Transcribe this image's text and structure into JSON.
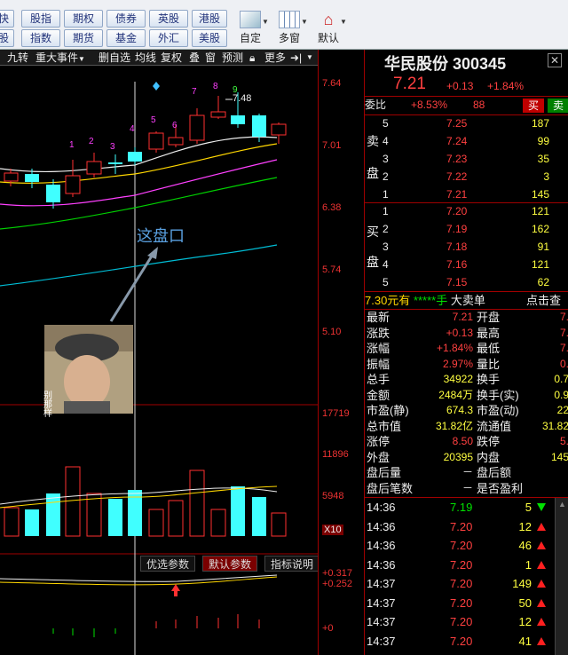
{
  "toolbar": {
    "row1": [
      "快",
      "股指",
      "期权",
      "债券",
      "英股",
      "港股"
    ],
    "row2": [
      "股",
      "指数",
      "期货",
      "基金",
      "外汇",
      "美股"
    ],
    "big": [
      "自定",
      "多窗",
      "默认"
    ]
  },
  "chartbar": {
    "items": [
      "九转",
      "重大事件",
      "删自选",
      "均线",
      "复权",
      "叠",
      "窗",
      "预测",
      "更多"
    ]
  },
  "axis": {
    "price": [
      "7.64",
      "7.01",
      "6.38",
      "5.74",
      "5.10"
    ],
    "volume": [
      "17719",
      "11896",
      "5948",
      "X10"
    ],
    "indicator": [
      "+0.317",
      "+0.252",
      "+0"
    ]
  },
  "chart": {
    "high_label": "7.48",
    "annotation": "这盘口",
    "meme_caption": "别那样",
    "seq_labels": [
      "1",
      "2",
      "3",
      "4",
      "5",
      "6",
      "7",
      "8",
      "9"
    ],
    "tabs": [
      "优选参数",
      "默认参数",
      "指标说明"
    ]
  },
  "stock": {
    "name": "华民股份",
    "code": "300345",
    "price": "7.21",
    "change": "+0.13",
    "pct": "+1.84%"
  },
  "order": {
    "wb_label": "委比",
    "wb": "+8.53%",
    "wc": "88",
    "sell_btn": "买",
    "buy_btn": "卖"
  },
  "asks": [
    {
      "lv": "5",
      "price": "7.25",
      "vol": "187"
    },
    {
      "lv": "4",
      "price": "7.24",
      "vol": "99"
    },
    {
      "lv": "3",
      "price": "7.23",
      "vol": "35"
    },
    {
      "lv": "2",
      "price": "7.22",
      "vol": "3"
    },
    {
      "lv": "1",
      "price": "7.21",
      "vol": "145"
    }
  ],
  "ask_side": [
    "卖",
    "盘"
  ],
  "bids": [
    {
      "lv": "1",
      "price": "7.20",
      "vol": "121"
    },
    {
      "lv": "2",
      "price": "7.19",
      "vol": "162"
    },
    {
      "lv": "3",
      "price": "7.18",
      "vol": "91"
    },
    {
      "lv": "4",
      "price": "7.16",
      "vol": "121"
    },
    {
      "lv": "5",
      "price": "7.15",
      "vol": "62"
    }
  ],
  "bid_side": [
    "买",
    "盘"
  ],
  "bigorder": {
    "price": "7.30元有",
    "stars": "*****手",
    "label": "大卖单",
    "link": "点击查"
  },
  "stats": [
    {
      "l": "最新",
      "v": "7.21",
      "l2": "开盘",
      "v2": "7."
    },
    {
      "l": "涨跌",
      "v": "+0.13",
      "l2": "最高",
      "v2": "7."
    },
    {
      "l": "涨幅",
      "v": "+1.84%",
      "l2": "最低",
      "v2": "7."
    },
    {
      "l": "振幅",
      "v": "2.97%",
      "l2": "量比",
      "v2": "0."
    },
    {
      "l": "总手",
      "v": "34922",
      "l2": "换手",
      "v2": "0.7"
    },
    {
      "l": "金额",
      "v": "2484万",
      "l2": "换手(实)",
      "v2": "0.9"
    },
    {
      "l": "市盈(静)",
      "v": "674.3",
      "l2": "市盈(动)",
      "v2": "22"
    },
    {
      "l": "总市值",
      "v": "31.82亿",
      "l2": "流通值",
      "v2": "31.82"
    },
    {
      "l": "涨停",
      "v": "8.50",
      "l2": "跌停",
      "v2": "5."
    },
    {
      "l": "外盘",
      "v": "20395",
      "l2": "内盘",
      "v2": "145"
    },
    {
      "l": "盘后量",
      "v": "－",
      "l2": "盘后额",
      "v2": ""
    },
    {
      "l": "盘后笔数",
      "v": "－",
      "l2": "是否盈利",
      "v2": ""
    }
  ],
  "ticks": [
    {
      "t": "14:36",
      "p": "7.19",
      "v": "5",
      "d": "down"
    },
    {
      "t": "14:36",
      "p": "7.20",
      "v": "12",
      "d": "up"
    },
    {
      "t": "14:36",
      "p": "7.20",
      "v": "46",
      "d": "up"
    },
    {
      "t": "14:36",
      "p": "7.20",
      "v": "1",
      "d": "up"
    },
    {
      "t": "14:37",
      "p": "7.20",
      "v": "149",
      "d": "up"
    },
    {
      "t": "14:37",
      "p": "7.20",
      "v": "50",
      "d": "up"
    },
    {
      "t": "14:37",
      "p": "7.20",
      "v": "12",
      "d": "up"
    },
    {
      "t": "14:37",
      "p": "7.20",
      "v": "41",
      "d": "up"
    }
  ]
}
